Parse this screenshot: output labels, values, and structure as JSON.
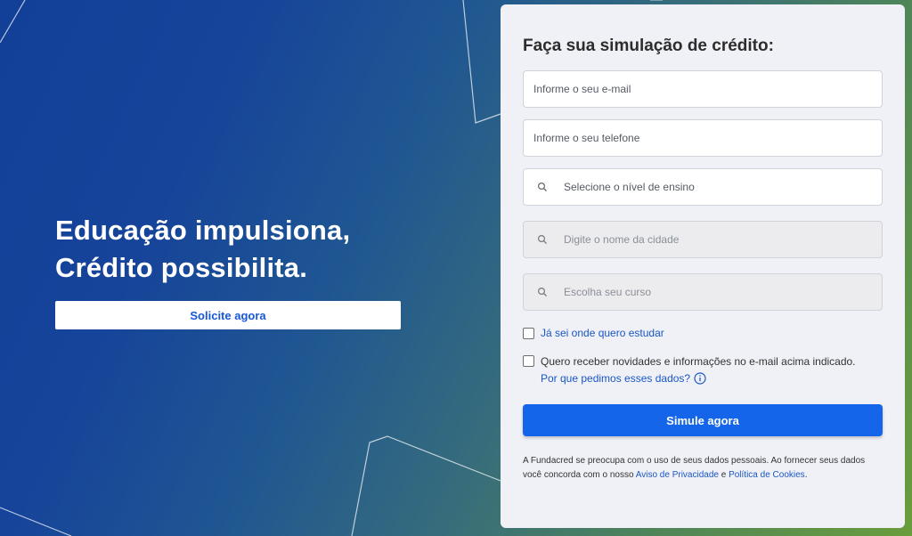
{
  "hero": {
    "title_line1": "Educação impulsiona,",
    "title_line2": "Crédito possibilita.",
    "cta_label": "Solicite agora"
  },
  "form": {
    "title": "Faça sua simulação de crédito:",
    "email_placeholder": "Informe o seu e-mail",
    "phone_placeholder": "Informe o seu telefone",
    "level_placeholder": "Selecione o nível de ensino",
    "city_placeholder": "Digite o nome da cidade",
    "course_placeholder": "Escolha seu curso",
    "know_where_label": "Já sei onde quero estudar",
    "newsletter_label": "Quero receber novidades e informações no e-mail acima indicado.",
    "why_link": "Por que pedimos esses dados?",
    "submit_label": "Simule agora",
    "disclaimer_text": "A Fundacred se preocupa com o uso de seus dados pessoais. Ao fornecer seus dados você concorda com o nosso",
    "privacy_link": "Aviso de Privacidade",
    "and_text": "e",
    "cookies_link": "Política de Cookies",
    "period": "."
  },
  "colors": {
    "primary": "#1565ea",
    "link": "#1a56c5",
    "panel_bg": "#f0f1f6"
  },
  "icons": [
    "search-icon",
    "info-icon"
  ]
}
